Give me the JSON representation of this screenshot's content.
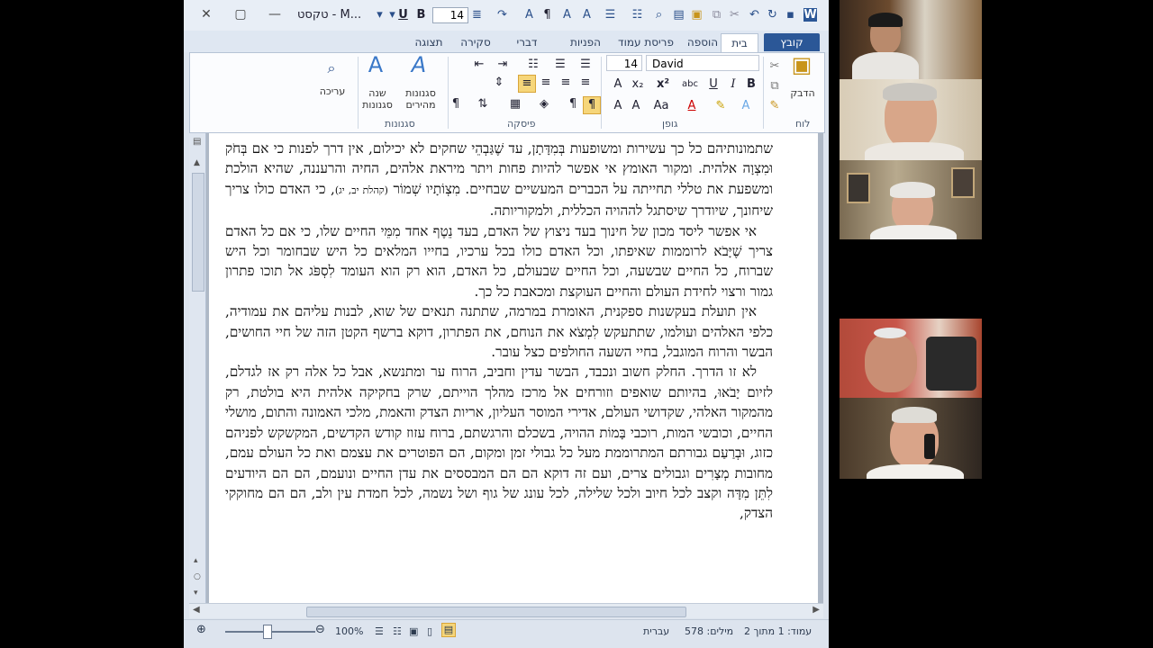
{
  "title_bar": {
    "font_size": "14",
    "style_name": "טקסט - M...",
    "bold": "B",
    "underline": "U"
  },
  "tabs": [
    "קובץ",
    "בית",
    "הוספה",
    "פריסת עמוד",
    "הפניות",
    "דברי דואר",
    "סקירה",
    "תצוגה"
  ],
  "ribbon": {
    "clipboard": {
      "paste": "הדבק",
      "label": "לוח"
    },
    "font": {
      "name": "David",
      "size": "14",
      "label": "גופן"
    },
    "paragraph": {
      "label": "פיסקה"
    },
    "styles": {
      "quick_styles": "סגנונות מהירים",
      "change_styles": "שנה סגנונות",
      "label": "סגנונות"
    },
    "editing": {
      "label": "עריכה"
    }
  },
  "document": {
    "paragraphs": [
      {
        "text": "שתמונותיהם כל כך עשירות ומשופעות בְּמִדָּתָן, עד שֶׁגַּבְהֵי שחקים לא יכילום, אין דרך לפנות כי אם בְּחֹק וּמִצְוָה אלהית. ומקור האומץ אי אפשר להיות פחות ויתר מיראת אלהים, החיה והרעננה, שהיא הולכת ומשפעת את טללי תחייתה על הכברים המעשיים שבחיים. מִצְוֹתָיו שְׁמוֹר",
        "ref": "(קהלת יב, יג)",
        "tail": ", כי האדם כולו צריך שיחונך, שיודרך שיסתגל לההויה הכללית, ולמקוריותה."
      },
      {
        "text": "אי אפשר ליסד מכון של חינוך בעד ניצוץ של האדם, בעד נֵטֶף אחד מִמֵּי החיים שלו, כי אם כל האדם צריך שֶׁיָּבֹא לרוממות שאיפתו, וכל האדם כולו בכל ערכיו, בחייו המלאים כל היש שבחומר וכל היש שברוח, כל החיים שבשעה, וכל החיים שבעולם, כל האדם, הוא רק הוא העומד לִסְפֹּג אל תוכו פתרון גמור ורצוי לחידת העולם והחיים העוקצת ומכאבת כל כך."
      },
      {
        "text": "אין תועלת בעקשנות ספקנית, האומרת במרמה, שתתנה תנאים של שוא, לבנות עליהם את עמודיה, כלפי האלהים ועולמו, שתתעקש לִמְצֹא את הנוחם, את הפתרון, דוקא ברשף הקטן הזה של חיי החושים, הבשר והרוח המוגבל, בחיי השעה החולפים כצל עובר."
      },
      {
        "text": "לא זו הדרך. החלק חשוב ונכבד, הבשר עדין וחביב, הרוח ער ומתנשא, אבל כל אלה רק אז לגדלם, לזיום יָבֹאוּ, בהיותם שואפים וזורחים אל מרכז מהלך הוייתם, שרק בחקיקה אלהית היא בולטת, רק מהמקור האלהי, שקדושי העולם, אדירי המוסר העליון, אריות הצדק והאמת, מלכי האמונה והתום, מושלי החיים, וכובשי המות, רוכבי בָּמוֹת ההויה, בשכלם והרגשתם, ברוח עזוז קודש הקדשים, המקשקש לפניהם כזוג, וּבְרַעַם גבורתם המתרוממת מעל כל גבולי זמן ומקום, הם הפוטרים את עצמם ואת כל העולם עמם, מחובות מְצָרִים וגבולים צרים, ועם זה דוקא הם הם המבססים את עדן החיים ונועמם, הם הם היודעים לִתֵּן מִדָּה וקצב לכל חיוב ולכל שלילה, לכל עונג של גוף ושל נשמה, לכל חמדת עין ולב, הם הם מחוקקי הצדק,"
      }
    ]
  },
  "status_bar": {
    "page": "עמוד: 1 מתוך 2",
    "words": "מילים: 578",
    "language": "עברית",
    "zoom": "100%"
  },
  "zoom_level": 1.0,
  "participants": [
    "participant-1",
    "participant-2",
    "participant-3",
    "participant-4",
    "participant-5"
  ]
}
